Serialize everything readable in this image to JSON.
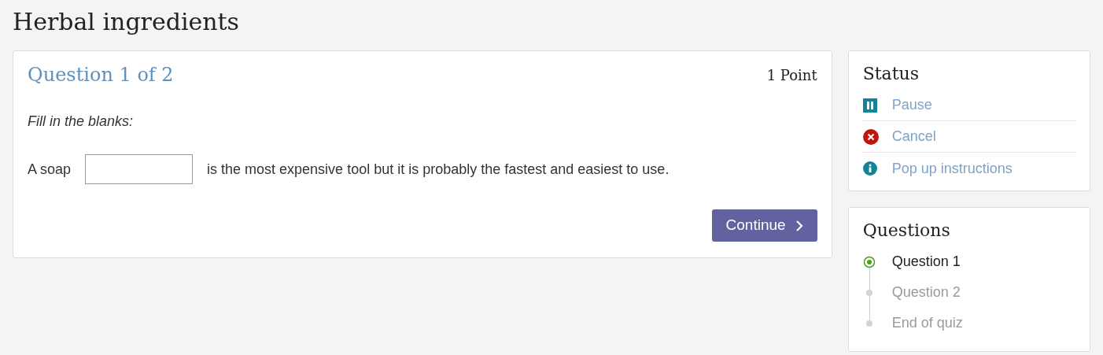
{
  "page": {
    "title": "Herbal ingredients"
  },
  "question": {
    "heading": "Question 1 of 2",
    "points": "1 Point",
    "instruction": "Fill in the blanks:",
    "before": "A soap",
    "after": "is the most expensive tool but it is probably the fastest and easiest to use.",
    "button": "Continue"
  },
  "status": {
    "title": "Status",
    "items": [
      {
        "kind": "pause",
        "label": "Pause"
      },
      {
        "kind": "cancel",
        "label": "Cancel"
      },
      {
        "kind": "info",
        "label": "Pop up instructions"
      }
    ]
  },
  "questions": {
    "title": "Questions",
    "items": [
      {
        "label": "Question 1",
        "selected": true
      },
      {
        "label": "Question 2",
        "selected": false
      },
      {
        "label": "End of quiz",
        "selected": false
      }
    ]
  }
}
